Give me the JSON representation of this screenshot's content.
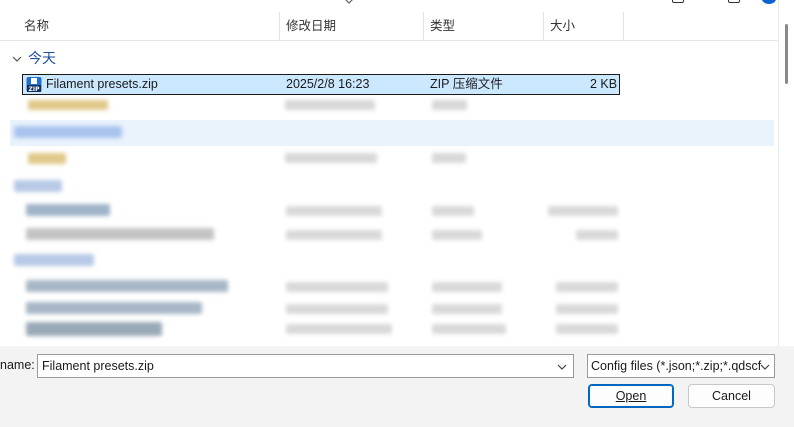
{
  "columns": {
    "name": "名称",
    "modified": "修改日期",
    "type": "类型",
    "size": "大小"
  },
  "group": {
    "label": "今天"
  },
  "selected_file": {
    "name": "Filament presets.zip",
    "modified": "2025/2/8 16:23",
    "type": "ZIP 压缩文件",
    "size": "2 KB"
  },
  "footer": {
    "filename_label": "name:",
    "filename_value": "Filament presets.zip",
    "filetype_value": "Config files (*.json;*.zip;*.qdscf",
    "open_label": "Open",
    "cancel_label": "Cancel"
  },
  "colors": {
    "selection": "#cce8ff",
    "accent": "#0067c0",
    "group_text": "#1d4fa0"
  }
}
